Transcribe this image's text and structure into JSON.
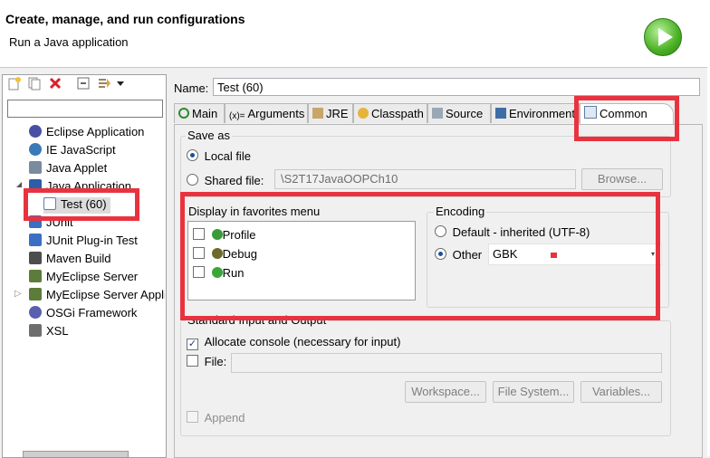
{
  "header": {
    "title": "Create, manage, and run configurations",
    "subtitle": "Run a Java application",
    "run_icon": "run-icon"
  },
  "toolbar": {
    "icons": [
      "new-configuration-icon",
      "duplicate-icon",
      "delete-icon",
      "collapse-all-icon",
      "filter-icon",
      "dropdown-arrow-icon"
    ]
  },
  "tree": {
    "items": [
      {
        "label": "Eclipse Application",
        "icon": "eclipse-icon",
        "color": "#4b4fa3"
      },
      {
        "label": "IE JavaScript",
        "icon": "globe-icon",
        "color": "#3a7ab8"
      },
      {
        "label": "Java Applet",
        "icon": "applet-icon",
        "color": "#7a8ba0"
      },
      {
        "label": "Java Application",
        "icon": "java-app-icon",
        "color": "#2c5ea8"
      },
      {
        "label": "Test (60)",
        "icon": "java-class-icon",
        "color": "#5b7fb8"
      },
      {
        "label": "JUnit",
        "icon": "junit-icon",
        "color": "#3b6fc4"
      },
      {
        "label": "JUnit Plug-in Test",
        "icon": "junit-plugin-icon",
        "color": "#3b6fc4"
      },
      {
        "label": "Maven Build",
        "icon": "maven-icon",
        "color": "#4d4d4d"
      },
      {
        "label": "MyEclipse Server",
        "icon": "server-icon",
        "color": "#5d7b3a"
      },
      {
        "label": "MyEclipse Server Application",
        "icon": "server-app-icon",
        "color": "#5d7b3a"
      },
      {
        "label": "OSGi Framework",
        "icon": "osgi-icon",
        "color": "#5b5fb0"
      },
      {
        "label": "XSL",
        "icon": "xsl-icon",
        "color": "#6e6e6e"
      }
    ]
  },
  "name_label": "Name:",
  "name_value": "Test (60)",
  "tabs": [
    {
      "label": "Main",
      "icon": "main-tab-icon"
    },
    {
      "label": "Arguments",
      "icon": "arguments-tab-icon"
    },
    {
      "label": "JRE",
      "icon": "jre-tab-icon"
    },
    {
      "label": "Classpath",
      "icon": "classpath-tab-icon"
    },
    {
      "label": "Source",
      "icon": "source-tab-icon"
    },
    {
      "label": "Environment",
      "icon": "environment-tab-icon"
    },
    {
      "label": "Common",
      "icon": "common-tab-icon"
    }
  ],
  "save_as": {
    "title": "Save as",
    "local_file": "Local file",
    "shared_file": "Shared file:",
    "shared_path": "\\S2T17JavaOOPCh10",
    "browse": "Browse..."
  },
  "favorites": {
    "title": "Display in favorites menu",
    "items": [
      "Profile",
      "Debug",
      "Run"
    ]
  },
  "encoding": {
    "title": "Encoding",
    "default": "Default - inherited (UTF-8)",
    "other": "Other",
    "other_value": "GBK"
  },
  "std_io": {
    "title": "Standard Input and Output",
    "allocate_console": "Allocate console (necessary for input)",
    "file": "File:",
    "workspace": "Workspace...",
    "file_system": "File System...",
    "variables": "Variables...",
    "append": "Append"
  },
  "annotation_color": "#e8333f"
}
